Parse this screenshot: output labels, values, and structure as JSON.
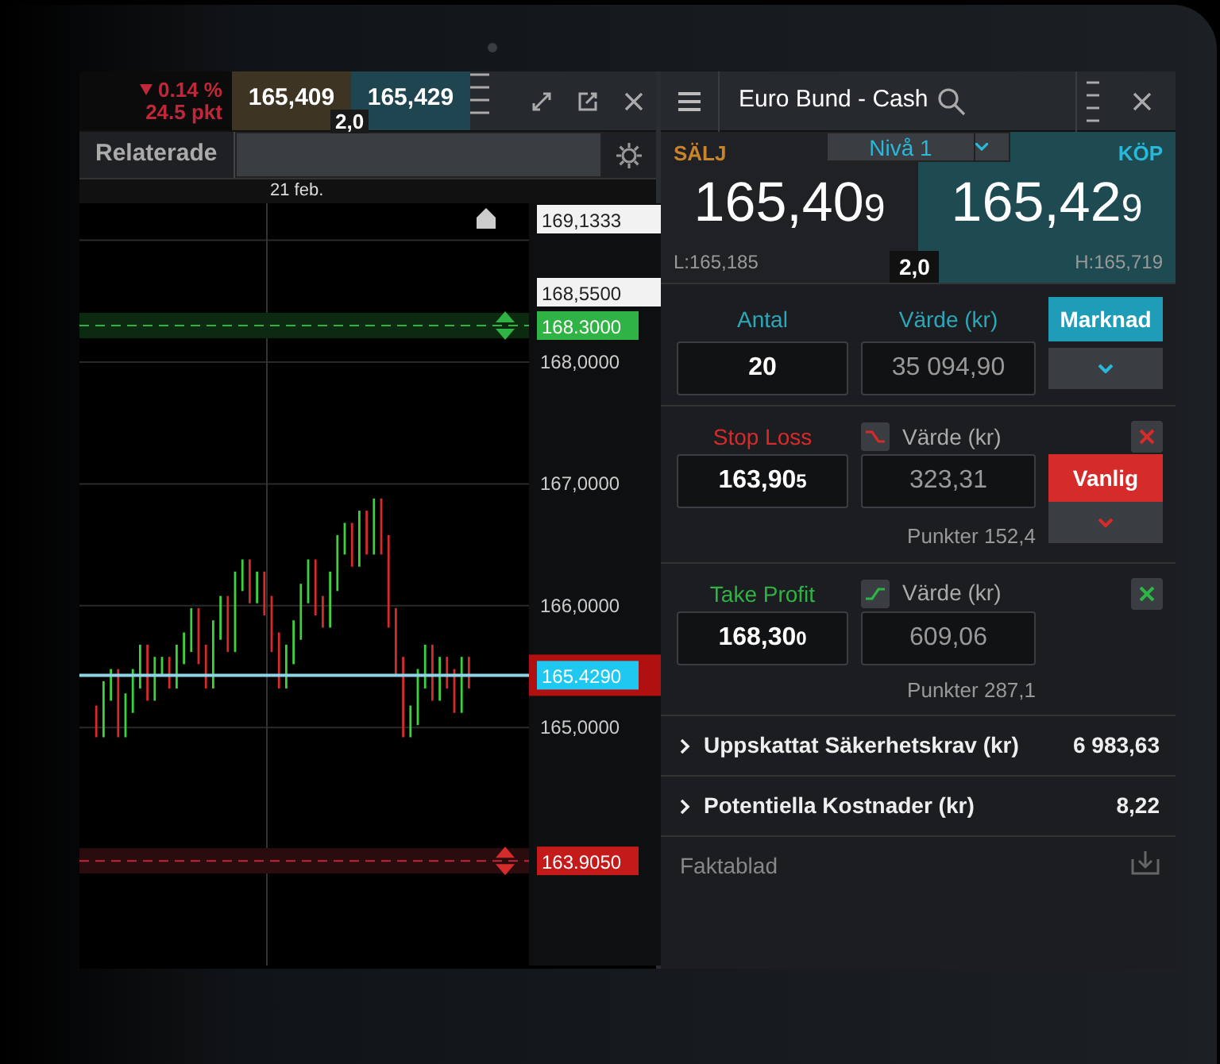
{
  "chart_panel": {
    "change": "0.14 %",
    "change_points": "24.5 pkt",
    "sell_price": "165,409",
    "buy_price": "165,429",
    "spread": "2,0",
    "tab": "Relaterade",
    "date": "21 feb.",
    "axis_ticks": [
      "168,0000",
      "167,0000",
      "166,0000",
      "165,0000"
    ],
    "price_tags": [
      {
        "kind": "high",
        "text": "169,1333"
      },
      {
        "kind": "level",
        "text": "168,5500"
      },
      {
        "kind": "take_profit",
        "text": "168.3000"
      },
      {
        "kind": "current",
        "text": "165.4290"
      },
      {
        "kind": "stop_loss",
        "text": "163.9050"
      }
    ]
  },
  "ticket": {
    "title": "Euro Bund - Cash",
    "sell_label": "SÄLJ",
    "buy_label": "KÖP",
    "level_select": "Nivå 1",
    "sell": {
      "main": "165,40",
      "pip": "9"
    },
    "buy": {
      "main": "165,42",
      "pip": "9"
    },
    "low": "L:165,185",
    "high": "H:165,719",
    "spread": "2,0",
    "order": {
      "quantity_label": "Antal",
      "value_label": "Värde (kr)",
      "quantity": "20",
      "value": "35 094,90",
      "type_button": "Marknad"
    },
    "conditions": [
      {
        "kind": "stop_loss",
        "label": "Stop Loss",
        "value_label": "Värde (kr)",
        "price_main": "163,90",
        "price_pip": "5",
        "value": "323,31",
        "type_button": "Vanlig",
        "points": "Punkter 152,4"
      },
      {
        "kind": "take_profit",
        "label": "Take Profit",
        "value_label": "Värde (kr)",
        "price_main": "168,30",
        "price_pip": "0",
        "value": "609,06",
        "points": "Punkter 287,1"
      }
    ],
    "summary": [
      {
        "label": "Uppskattat Säkerhetskrav (kr)",
        "value": "6 983,63"
      },
      {
        "label": "Potentiella Kostnader (kr)",
        "value": "8,22"
      }
    ],
    "factsheet": "Faktablad"
  }
}
